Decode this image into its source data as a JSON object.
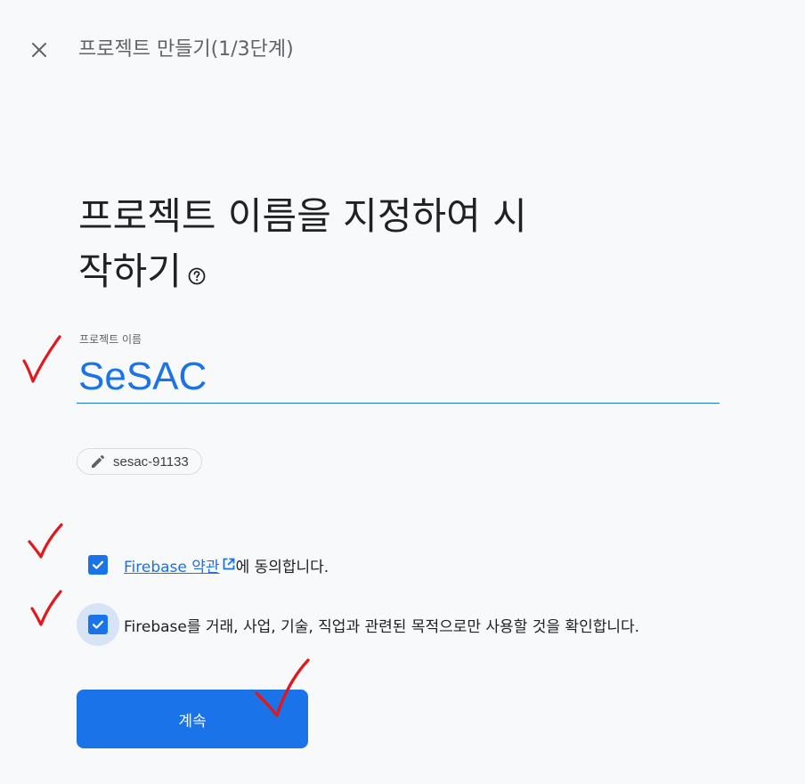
{
  "header": {
    "close_icon": "close-icon",
    "step_title": "프로젝트 만들기(1/3단계)"
  },
  "main": {
    "heading_line1": "프로젝트 이름을 지정하여 시",
    "heading_line2": "작하기",
    "help_icon": "help-circle-icon"
  },
  "form": {
    "project_name_label": "프로젝트 이름",
    "project_name_value": "SeSAC",
    "project_id": "sesac-91133",
    "edit_icon": "pencil-icon"
  },
  "consent": {
    "terms_link": "Firebase 약관",
    "terms_suffix": "에 동의합니다.",
    "terms_checked": true,
    "business_text": "Firebase를 거래, 사업, 기술, 직업과 관련된 목적으로만 사용할 것을 확인합니다.",
    "business_checked": true
  },
  "actions": {
    "continue_label": "계속"
  },
  "colors": {
    "accent": "#1a73e8",
    "annotation": "#e0191e",
    "background": "#f8f9fa"
  }
}
